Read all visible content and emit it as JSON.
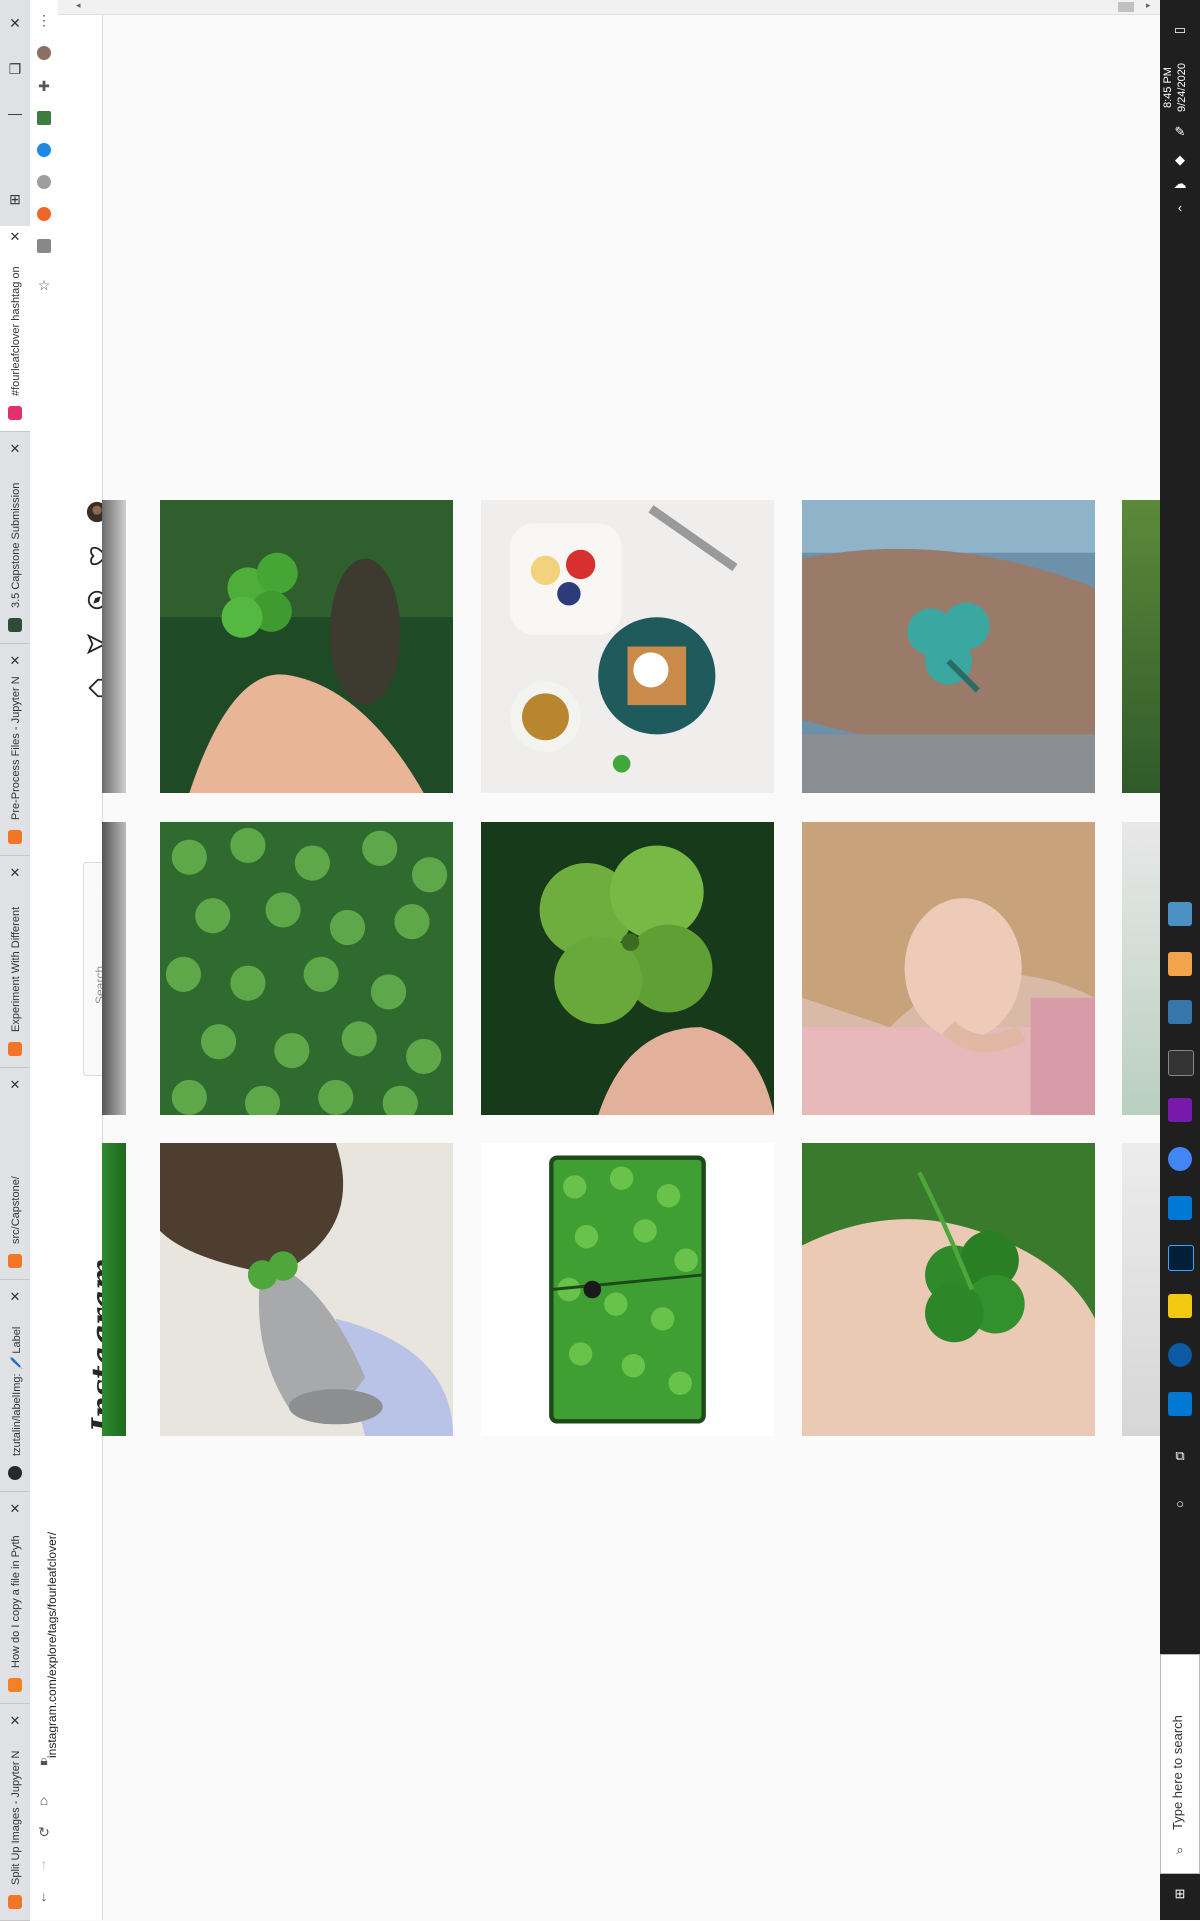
{
  "browser": {
    "tabs": [
      {
        "title": "Split Up Images - Jupyter N",
        "favicon_color": "#f37626"
      },
      {
        "title": "How do I copy a file in Pyth",
        "favicon_color": "#f48024"
      },
      {
        "title": "tzutalin/labelImg: 🖊️ Label",
        "favicon_color": "#24292e"
      },
      {
        "title": "src/Capstone/",
        "favicon_color": "#f37626"
      },
      {
        "title": "Experiment With Different",
        "favicon_color": "#f37626"
      },
      {
        "title": "Pre-Process Files - Jupyter N",
        "favicon_color": "#f37626"
      },
      {
        "title": "3.5 Capstone Submission",
        "favicon_color": "#2d4b3a"
      },
      {
        "title": "#fourleafclover hashtag on",
        "favicon_color": "#e1306c",
        "active": true
      }
    ],
    "url": "instagram.com/explore/tags/fourleafclover/",
    "icons": [
      "close-window",
      "restore",
      "minimize",
      "snap-layout",
      "menu",
      "back",
      "forward",
      "reload",
      "home",
      "star"
    ]
  },
  "instagram": {
    "logo": "Instagram",
    "search_placeholder": "Search",
    "nav_icons": [
      "home-icon",
      "direct-icon",
      "explore-icon",
      "activity-icon",
      "profile-avatar"
    ],
    "posts": [
      {
        "label": "hand holding four-leaf clover on grass",
        "row": 1,
        "col": 1
      },
      {
        "label": "breakfast waffles and fruit with clover",
        "row": 1,
        "col": 2
      },
      {
        "label": "four-leaf clover tattoo",
        "row": 1,
        "col": 3
      },
      {
        "label": "field of clover",
        "row": 2,
        "col": 1
      },
      {
        "label": "close-up four-leaf clover",
        "row": 2,
        "col": 2
      },
      {
        "label": "woman with blonde hair",
        "row": 2,
        "col": 3
      },
      {
        "label": "shaving brush with clover",
        "row": 3,
        "col": 1
      },
      {
        "label": "clover pattern wallet",
        "row": 3,
        "col": 2
      },
      {
        "label": "clover in palm",
        "row": 3,
        "col": 3
      }
    ]
  },
  "taskbar": {
    "time": "8:45 PM",
    "date": "9/24/2020",
    "search_placeholder": "Type here to search",
    "apps": [
      {
        "name": "file-explorer-icon",
        "color": "#4a90c2"
      },
      {
        "name": "brackets-icon",
        "color": "#f3a34b"
      },
      {
        "name": "python-icon",
        "color": "#3776ab"
      },
      {
        "name": "terminal-icon",
        "color": "#333333"
      },
      {
        "name": "onenote-icon",
        "color": "#7719aa"
      },
      {
        "name": "chrome-icon",
        "color": "#4285f4"
      },
      {
        "name": "vscode-icon",
        "color": "#0078d4"
      },
      {
        "name": "photoshop-icon",
        "color": "#001e36"
      },
      {
        "name": "sticky-notes-icon",
        "color": "#f2c811"
      },
      {
        "name": "edge-icon",
        "color": "#0c59a4"
      },
      {
        "name": "store-icon",
        "color": "#0078d4"
      }
    ]
  }
}
